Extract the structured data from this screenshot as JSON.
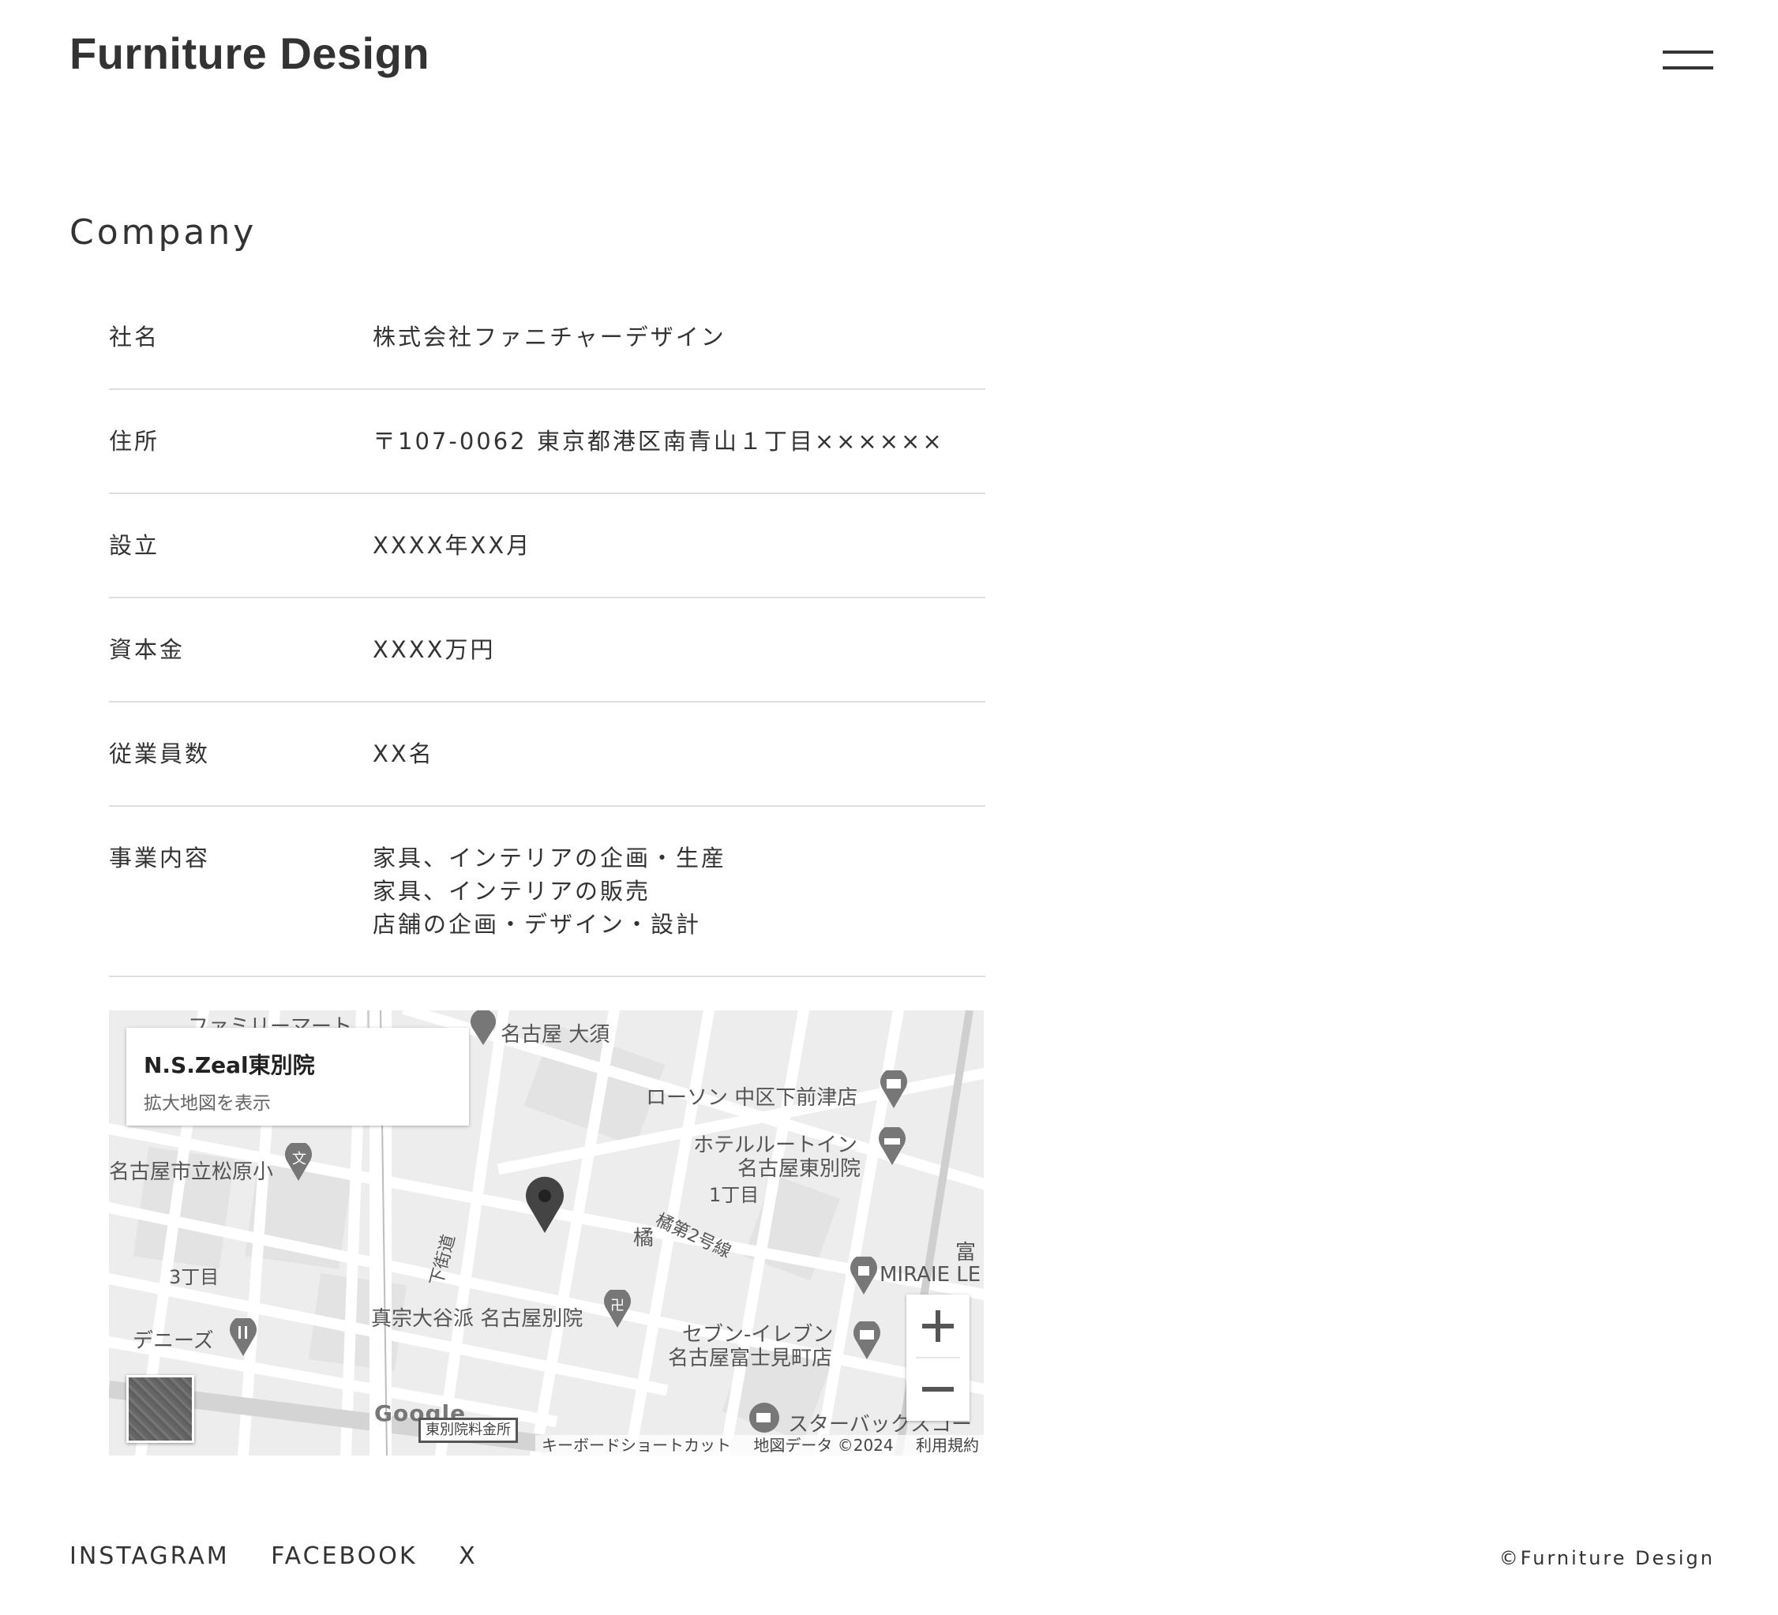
{
  "header": {
    "logo": "Furniture Design",
    "menu_icon": "hamburger-menu-icon"
  },
  "section": {
    "title": "Company"
  },
  "company": {
    "rows": [
      {
        "label": "社名",
        "value": "株式会社ファニチャーデザイン"
      },
      {
        "label": "住所",
        "value": "〒107-0062 東京都港区南青山１丁目××××××"
      },
      {
        "label": "設立",
        "value": "XXXX年XX月"
      },
      {
        "label": "資本金",
        "value": "XXXX万円"
      },
      {
        "label": "従業員数",
        "value": "XX名"
      },
      {
        "label": "事業内容",
        "lines": [
          "家具、インテリアの企画・生産",
          "家具、インテリアの販売",
          "店舗の企画・デザイン・設計"
        ]
      }
    ]
  },
  "map": {
    "place_name": "N.S.Zeal東別院",
    "view_larger": "拡大地図を表示",
    "labels": {
      "nagoya_osu": "名古屋 大須",
      "lawson": "ローソン 中区下前津店",
      "hotel_1": "ホテルルートイン",
      "hotel_2": "名古屋東別院",
      "school": "名古屋市立松原小",
      "chome1": "1丁目",
      "tachibana_line": "橘第2号線",
      "tachibana": "橘",
      "shitakaido": "下街道",
      "chome3": "3丁目",
      "temple": "真宗大谷派 名古屋別院",
      "seven_1": "セブン-イレブン",
      "seven_2": "名古屋富士見町店",
      "dennys": "デニーズ",
      "starbucks": "スターバックスコー",
      "miraie": "MIRAIE LE",
      "family": "ファミリーマート",
      "tomi": "富"
    },
    "toll": "東別院料金所",
    "google": "Google",
    "attribution": {
      "shortcuts": "キーボードショートカット",
      "data": "地図データ ©2024",
      "terms": "利用規約"
    },
    "zoom_in_icon": "plus-icon",
    "zoom_out_icon": "minus-icon"
  },
  "footer": {
    "links": [
      "INSTAGRAM",
      "FACEBOOK",
      "X"
    ],
    "copyright": "©Furniture Design"
  }
}
